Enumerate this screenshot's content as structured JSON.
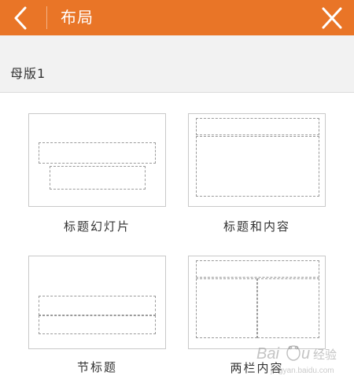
{
  "header": {
    "title": "布局",
    "back_icon": "chevron-left-icon",
    "close_icon": "close-icon",
    "background_color": "#e97527"
  },
  "section": {
    "title": "母版1"
  },
  "layouts": [
    {
      "label": "标题幻灯片"
    },
    {
      "label": "标题和内容"
    },
    {
      "label": "节标题"
    },
    {
      "label": "两栏内容"
    }
  ],
  "watermark": {
    "text": "Baidu经验",
    "sub": "jingyan.baidu.com"
  }
}
